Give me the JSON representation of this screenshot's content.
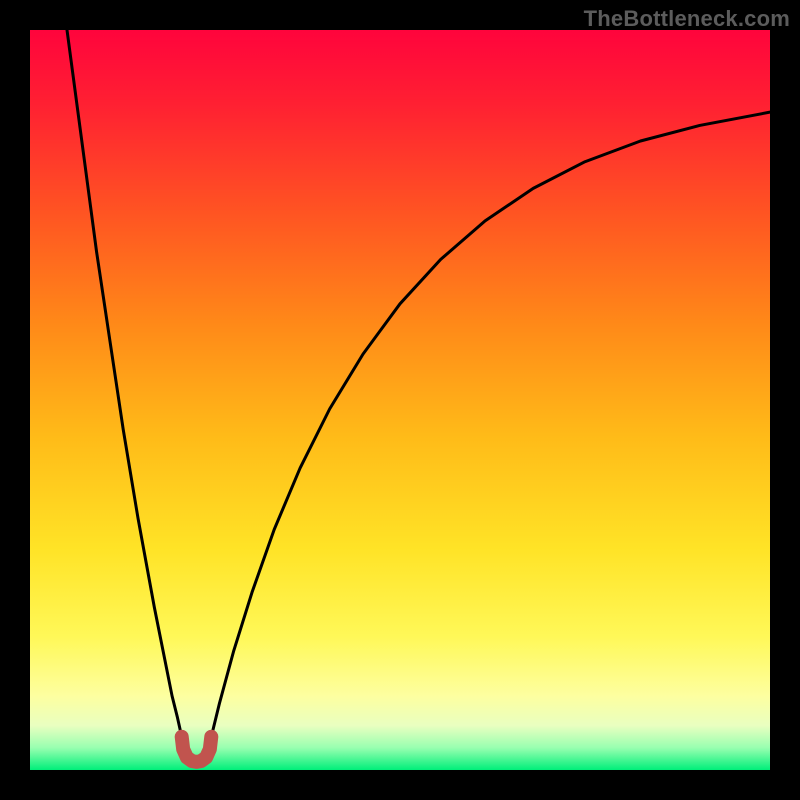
{
  "watermark": "TheBottleneck.com",
  "chart_data": {
    "type": "line",
    "title": "",
    "xlabel": "",
    "ylabel": "",
    "xlim": [
      0,
      1
    ],
    "ylim": [
      0,
      1
    ],
    "background_gradient": {
      "stops": [
        {
          "offset": 0.0,
          "color": "#ff043c"
        },
        {
          "offset": 0.1,
          "color": "#ff2032"
        },
        {
          "offset": 0.25,
          "color": "#ff5522"
        },
        {
          "offset": 0.4,
          "color": "#ff8a18"
        },
        {
          "offset": 0.55,
          "color": "#ffbb18"
        },
        {
          "offset": 0.7,
          "color": "#ffe326"
        },
        {
          "offset": 0.82,
          "color": "#fff858"
        },
        {
          "offset": 0.9,
          "color": "#fdffa0"
        },
        {
          "offset": 0.94,
          "color": "#e9ffc0"
        },
        {
          "offset": 0.97,
          "color": "#98ffb0"
        },
        {
          "offset": 1.0,
          "color": "#00ef7a"
        }
      ]
    },
    "series": [
      {
        "name": "curve-left",
        "stroke": "#000000",
        "stroke_width": 3,
        "points": [
          {
            "x": 0.05,
            "y": 1.0
          },
          {
            "x": 0.058,
            "y": 0.94
          },
          {
            "x": 0.066,
            "y": 0.88
          },
          {
            "x": 0.074,
            "y": 0.82
          },
          {
            "x": 0.082,
            "y": 0.76
          },
          {
            "x": 0.09,
            "y": 0.7
          },
          {
            "x": 0.099,
            "y": 0.64
          },
          {
            "x": 0.108,
            "y": 0.58
          },
          {
            "x": 0.117,
            "y": 0.52
          },
          {
            "x": 0.126,
            "y": 0.46
          },
          {
            "x": 0.136,
            "y": 0.4
          },
          {
            "x": 0.146,
            "y": 0.34
          },
          {
            "x": 0.157,
            "y": 0.28
          },
          {
            "x": 0.168,
            "y": 0.22
          },
          {
            "x": 0.18,
            "y": 0.16
          },
          {
            "x": 0.192,
            "y": 0.1
          },
          {
            "x": 0.199,
            "y": 0.072
          },
          {
            "x": 0.205,
            "y": 0.045
          }
        ]
      },
      {
        "name": "curve-right",
        "stroke": "#000000",
        "stroke_width": 3,
        "points": [
          {
            "x": 0.245,
            "y": 0.045
          },
          {
            "x": 0.256,
            "y": 0.09
          },
          {
            "x": 0.275,
            "y": 0.16
          },
          {
            "x": 0.3,
            "y": 0.24
          },
          {
            "x": 0.33,
            "y": 0.325
          },
          {
            "x": 0.365,
            "y": 0.408
          },
          {
            "x": 0.405,
            "y": 0.488
          },
          {
            "x": 0.45,
            "y": 0.562
          },
          {
            "x": 0.5,
            "y": 0.63
          },
          {
            "x": 0.555,
            "y": 0.69
          },
          {
            "x": 0.615,
            "y": 0.742
          },
          {
            "x": 0.68,
            "y": 0.786
          },
          {
            "x": 0.75,
            "y": 0.822
          },
          {
            "x": 0.825,
            "y": 0.85
          },
          {
            "x": 0.905,
            "y": 0.871
          },
          {
            "x": 1.0,
            "y": 0.889
          }
        ]
      },
      {
        "name": "marker-u",
        "stroke": "#c1544e",
        "stroke_width": 14,
        "points": [
          {
            "x": 0.205,
            "y": 0.045
          },
          {
            "x": 0.207,
            "y": 0.028
          },
          {
            "x": 0.212,
            "y": 0.017
          },
          {
            "x": 0.219,
            "y": 0.012
          },
          {
            "x": 0.225,
            "y": 0.011
          },
          {
            "x": 0.231,
            "y": 0.012
          },
          {
            "x": 0.238,
            "y": 0.017
          },
          {
            "x": 0.243,
            "y": 0.028
          },
          {
            "x": 0.245,
            "y": 0.045
          }
        ]
      }
    ]
  }
}
